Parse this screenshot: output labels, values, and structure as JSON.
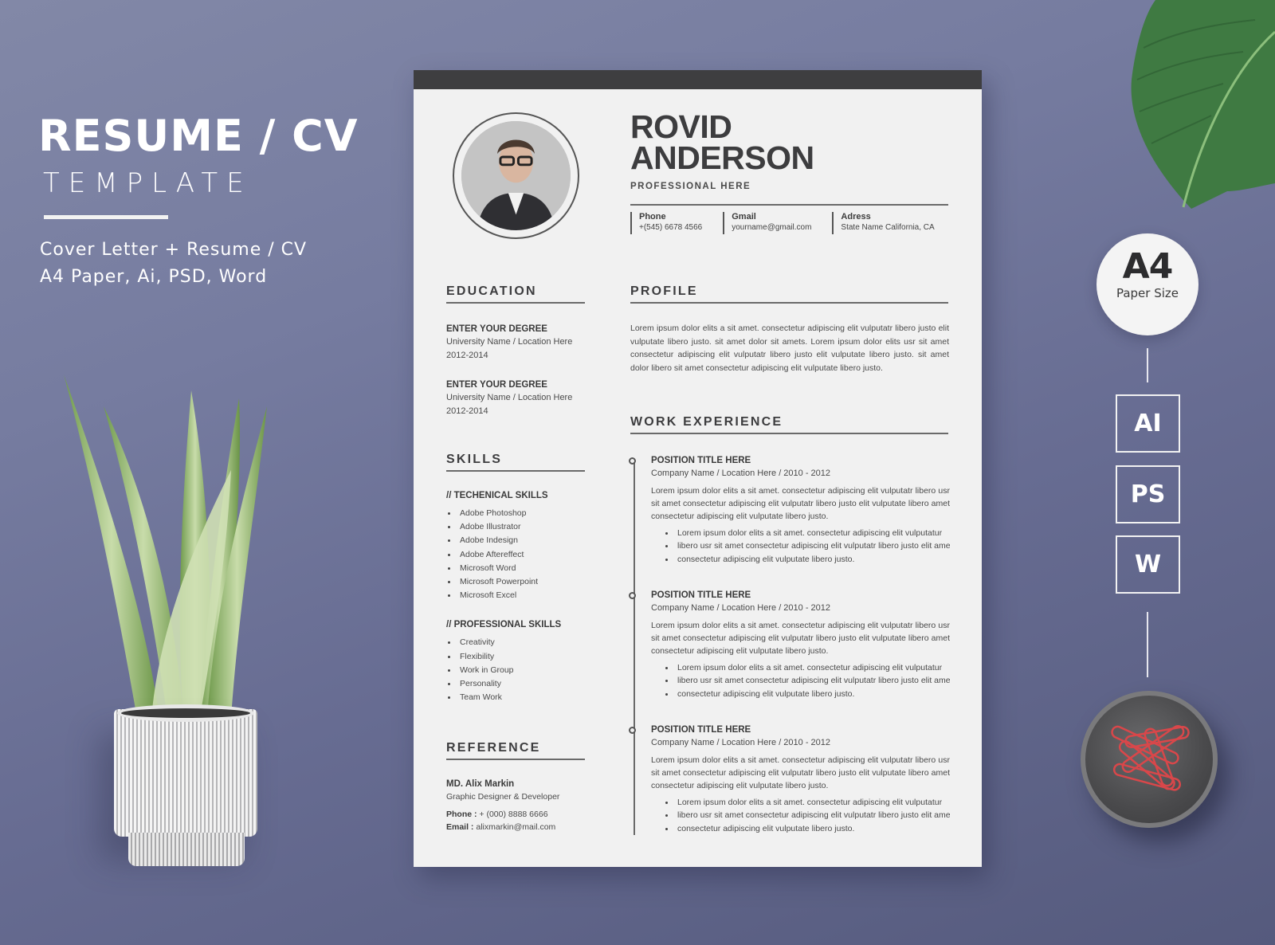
{
  "promo": {
    "title": "RESUME / CV",
    "subtitle": "TEMPLATE",
    "line1": "Cover Letter + Resume / CV",
    "line2": "A4 Paper, Ai, PSD, Word"
  },
  "badge": {
    "size": "A4",
    "label": "Paper Size"
  },
  "formats": [
    "AI",
    "PS",
    "W"
  ],
  "resume": {
    "first_name": "ROVID",
    "last_name": "ANDERSON",
    "profession": "PROFESSIONAL HERE",
    "contacts": [
      {
        "label": "Phone",
        "value": "+(545) 6678 4566"
      },
      {
        "label": "Gmail",
        "value": "yourname@gmail.com"
      },
      {
        "label": "Adress",
        "value": "State Name California, CA"
      }
    ],
    "education": {
      "title": "EDUCATION",
      "items": [
        {
          "degree": "ENTER YOUR DEGREE",
          "school": "University Name / Location Here",
          "years": "2012-2014"
        },
        {
          "degree": "ENTER YOUR DEGREE",
          "school": "University Name / Location Here",
          "years": "2012-2014"
        }
      ]
    },
    "skills": {
      "title": "SKILLS",
      "technical_title": "//  TECHENICAL SKILLS",
      "technical": [
        "Adobe Photoshop",
        "Adobe Illustrator",
        "Adobe Indesign",
        "Adobe Aftereffect",
        "Microsoft Word",
        "Microsoft Powerpoint",
        "Microsoft Excel"
      ],
      "professional_title": "//  PROFESSIONAL SKILLS",
      "professional": [
        "Creativity",
        "Flexibility",
        "Work in Group",
        "Personality",
        "Team Work"
      ]
    },
    "reference": {
      "title": "REFERENCE",
      "name": "MD. Alix Markin",
      "role": "Graphic Designer & Developer",
      "phone_label": "Phone :",
      "phone": " + (000) 8888 6666",
      "email_label": "Email :",
      "email": " alixmarkin@mail.com"
    },
    "profile": {
      "title": "PROFILE",
      "text": "Lorem ipsum dolor elits a sit amet. consectetur adipiscing elit vulputatr libero justo elit vulputate libero justo. sit amet dolor sit amets. Lorem ipsum dolor elits usr sit amet consectetur adipiscing elit vulputatr libero justo elit vulputate libero justo. sit amet dolor libero sit amet consectetur adipiscing elit vulputate libero justo."
    },
    "work": {
      "title": "WORK EXPERIENCE",
      "jobs": [
        {
          "title": "POSITION TITLE HERE",
          "company": "Company Name / Location Here / 2010 - 2012",
          "desc": "Lorem ipsum dolor elits a sit amet. consectetur adipiscing elit vulputatr libero usr sit amet consectetur adipiscing elit vulputatr libero justo elit vulputate libero amet consectetur adipiscing elit vulputate libero justo.",
          "bullets": [
            "Lorem ipsum dolor elits a sit amet. consectetur adipiscing elit vulputatur",
            "libero usr sit amet consectetur adipiscing elit vulputatr libero justo elit amet",
            "consectetur adipiscing elit vulputate libero justo."
          ]
        },
        {
          "title": "POSITION TITLE HERE",
          "company": "Company Name / Location Here / 2010 - 2012",
          "desc": "Lorem ipsum dolor elits a sit amet. consectetur adipiscing elit vulputatr libero usr sit amet consectetur adipiscing elit vulputatr libero justo elit vulputate libero amet consectetur adipiscing elit vulputate libero justo.",
          "bullets": [
            "Lorem ipsum dolor elits a sit amet. consectetur adipiscing elit vulputatur",
            "libero usr sit amet consectetur adipiscing elit vulputatr libero justo elit amet",
            "consectetur adipiscing elit vulputate libero justo."
          ]
        },
        {
          "title": "POSITION TITLE HERE",
          "company": "Company Name / Location Here / 2010 - 2012",
          "desc": "Lorem ipsum dolor elits a sit amet. consectetur adipiscing elit vulputatr libero usr sit amet consectetur adipiscing elit vulputatr libero justo elit vulputate libero amet consectetur adipiscing elit vulputate libero justo.",
          "bullets": [
            "Lorem ipsum dolor elits a sit amet. consectetur adipiscing elit vulputatur",
            "libero usr sit amet consectetur adipiscing elit vulputatr libero justo elit amet",
            "consectetur adipiscing elit vulputate libero justo."
          ]
        }
      ]
    }
  }
}
